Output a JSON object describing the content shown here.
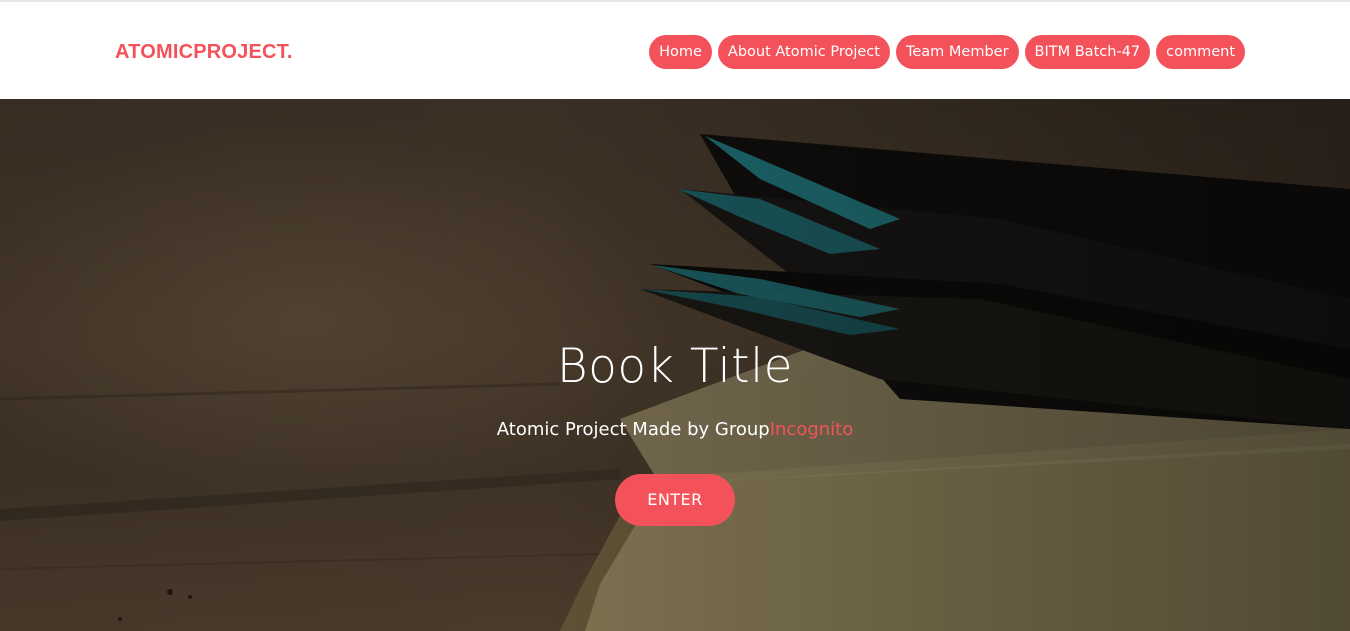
{
  "header": {
    "brand": "ATOMICPROJECT.",
    "nav": [
      {
        "label": "Home"
      },
      {
        "label": "About Atomic Project"
      },
      {
        "label": "Team Member"
      },
      {
        "label": "BITM Batch-47"
      },
      {
        "label": "comment"
      }
    ]
  },
  "hero": {
    "title": "Book Title",
    "subtitle_prefix": "Atomic Project Made by Group",
    "subtitle_accent": "Incognito",
    "enter_label": "ENTER"
  },
  "colors": {
    "accent": "#f4525a",
    "navbar_bg": "#ffffff",
    "hero_text": "#ffffff",
    "hero_bg_dark": "#3a2f24"
  }
}
